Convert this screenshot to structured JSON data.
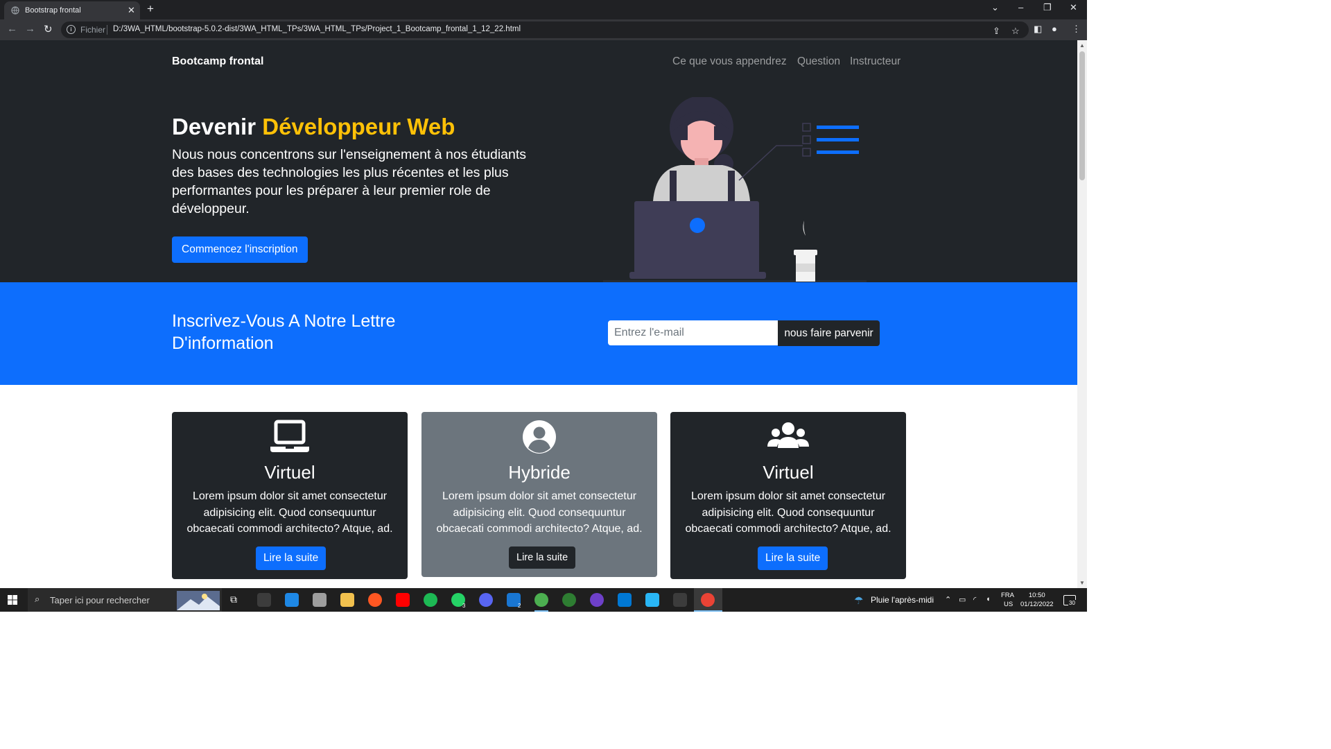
{
  "browser": {
    "tab_title": "Bootstrap frontal",
    "scheme_label": "Fichier",
    "url": "D:/3WA_HTML/bootstrap-5.0.2-dist/3WA_HTML_TPs/3WA_HTML_TPs/Project_1_Bootcamp_frontal_1_12_22.html"
  },
  "navbar": {
    "brand": "Bootcamp frontal",
    "links": [
      "Ce que vous appendrez",
      "Question",
      "Instructeur"
    ]
  },
  "hero": {
    "title_prefix": "Devenir",
    "title_accent": "Développeur Web",
    "lead": "Nous nous concentrons sur l'enseignement à nos étudiants des bases des technologies les plus récentes et les plus performantes pour les préparer à leur premier role de développeur.",
    "button": "Commencez l'inscription",
    "colors": {
      "accent": "#ffc107",
      "primary": "#0d6efd",
      "dark": "#212529"
    }
  },
  "newsletter": {
    "title": "Inscrivez-Vous A Notre Lettre D'information",
    "placeholder": "Entrez l'e-mail",
    "button": "nous faire parvenir"
  },
  "cards": [
    {
      "icon": "laptop-icon",
      "title": "Virtuel",
      "text": "Lorem ipsum dolor sit amet consectetur adipisicing elit. Quod consequuntur obcaecati commodi architecto? Atque, ad.",
      "button": "Lire la suite"
    },
    {
      "icon": "user-circle-icon",
      "title": "Hybride",
      "text": "Lorem ipsum dolor sit amet consectetur adipisicing elit. Quod consequuntur obcaecati commodi architecto? Atque, ad.",
      "button": "Lire la suite"
    },
    {
      "icon": "users-icon",
      "title": "Virtuel",
      "text": "Lorem ipsum dolor sit amet consectetur adipisicing elit. Quod consequuntur obcaecati commodi architecto? Atque, ad.",
      "button": "Lire la suite"
    }
  ],
  "taskbar": {
    "search_placeholder": "Taper ici pour rechercher",
    "whatsapp_badge": "3",
    "discord_badge": "2",
    "weather": "Pluie l'après-midi",
    "lang_1": "FRA",
    "lang_2": "US",
    "time": "10:50",
    "date": "01/12/2022",
    "notifications": "30"
  }
}
